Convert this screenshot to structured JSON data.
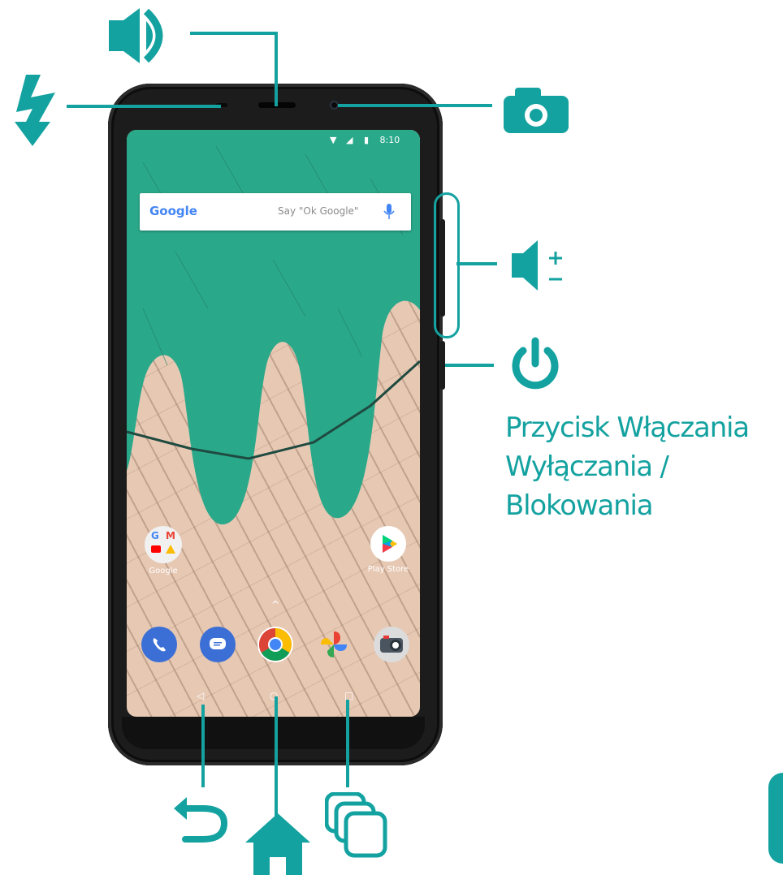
{
  "status_bar": {
    "time": "8:10"
  },
  "search_widget": {
    "logo": "Google",
    "hint": "Say \"Ok Google\""
  },
  "apps": {
    "google_folder": "Google",
    "play_store": "Play Store"
  },
  "dock": [
    "phone-icon",
    "messages-icon",
    "chrome-icon",
    "photos-icon",
    "camera-icon"
  ],
  "callout_label": {
    "line1": "Przycisk Włączania",
    "line2": "Wyłączania /",
    "line3": "Blokowania"
  },
  "colors": {
    "accent": "#14a2a0",
    "wallpaper_green": "#2aa88a",
    "wallpaper_brick": "#e7c8b3",
    "phone_body": "#1c1c1c"
  },
  "icons": [
    "speaker-icon",
    "flash-icon",
    "camera-icon",
    "volume-icon",
    "power-icon",
    "back-icon",
    "home-icon",
    "recent-apps-icon"
  ]
}
